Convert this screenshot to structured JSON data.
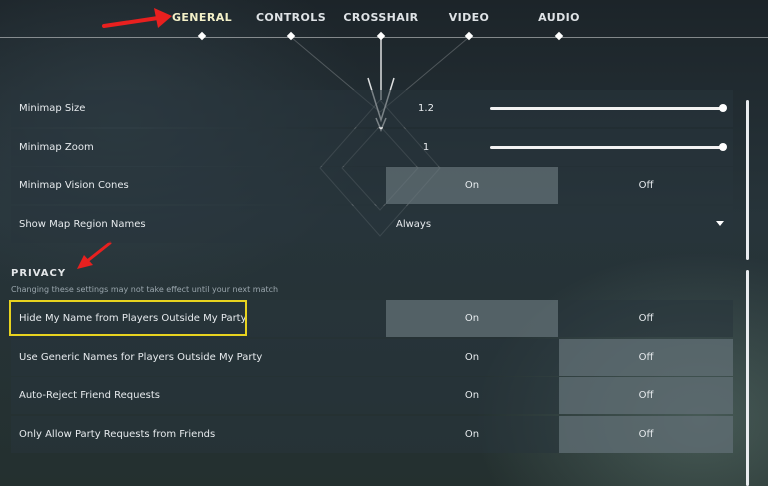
{
  "tabs": [
    {
      "label": "GENERAL",
      "active": true
    },
    {
      "label": "CONTROLS",
      "active": false
    },
    {
      "label": "CROSSHAIR",
      "active": false
    },
    {
      "label": "VIDEO",
      "active": false
    },
    {
      "label": "AUDIO",
      "active": false
    }
  ],
  "map_settings": {
    "minimap_size": {
      "label": "Minimap Size",
      "value": "1.2",
      "slider_fraction": 1.0
    },
    "minimap_zoom": {
      "label": "Minimap Zoom",
      "value": "1",
      "slider_fraction": 1.0
    },
    "minimap_vision_cones": {
      "label": "Minimap Vision Cones",
      "on_label": "On",
      "off_label": "Off",
      "selected": "On"
    },
    "show_map_region_names": {
      "label": "Show Map Region Names",
      "value": "Always"
    }
  },
  "privacy": {
    "title": "PRIVACY",
    "subtitle": "Changing these settings may not take effect until your next match",
    "rows": [
      {
        "label": "Hide My Name from Players Outside My Party",
        "on_label": "On",
        "off_label": "Off",
        "selected": "On"
      },
      {
        "label": "Use Generic Names for Players Outside My Party",
        "on_label": "On",
        "off_label": "Off",
        "selected": "Off"
      },
      {
        "label": "Auto-Reject Friend Requests",
        "on_label": "On",
        "off_label": "Off",
        "selected": "Off"
      },
      {
        "label": "Only Allow Party Requests from Friends",
        "on_label": "On",
        "off_label": "Off",
        "selected": "Off"
      }
    ]
  },
  "colors": {
    "annotation_arrow": "#e8201f",
    "highlight_box": "#e8d31f",
    "active_tab": "#f3f0c8"
  }
}
